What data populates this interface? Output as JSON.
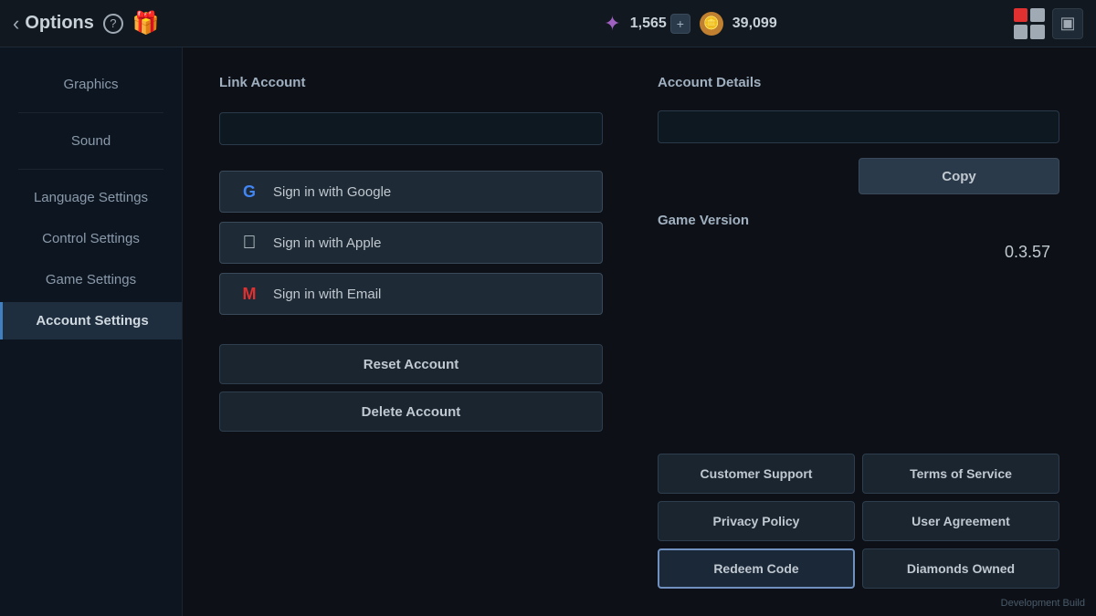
{
  "topbar": {
    "back_label": "Options",
    "help_icon": "?",
    "currency1_value": "1,565",
    "currency1_plus": "+",
    "currency2_value": "39,099",
    "dev_build": "Development Build"
  },
  "sidebar": {
    "items": [
      {
        "id": "graphics",
        "label": "Graphics",
        "active": false
      },
      {
        "id": "sound",
        "label": "Sound",
        "active": false
      },
      {
        "id": "language",
        "label": "Language Settings",
        "active": false
      },
      {
        "id": "control",
        "label": "Control Settings",
        "active": false
      },
      {
        "id": "game",
        "label": "Game Settings",
        "active": false
      },
      {
        "id": "account",
        "label": "Account Settings",
        "active": true
      }
    ]
  },
  "left_panel": {
    "link_account_label": "Link Account",
    "sign_in_buttons": [
      {
        "id": "google",
        "label": "Sign in with Google",
        "icon": "G"
      },
      {
        "id": "apple",
        "label": "Sign in with Apple",
        "icon": ""
      },
      {
        "id": "email",
        "label": "Sign in with Email",
        "icon": "M"
      }
    ],
    "reset_account_label": "Reset Account",
    "delete_account_label": "Delete Account"
  },
  "right_panel": {
    "account_details_label": "Account Details",
    "copy_label": "Copy",
    "game_version_label": "Game Version",
    "game_version_value": "0.3.57",
    "bottom_buttons": [
      {
        "id": "customer-support",
        "label": "Customer Support",
        "highlighted": false
      },
      {
        "id": "terms-of-service",
        "label": "Terms of Service",
        "highlighted": false
      },
      {
        "id": "privacy-policy",
        "label": "Privacy Policy",
        "highlighted": false
      },
      {
        "id": "user-agreement",
        "label": "User Agreement",
        "highlighted": false
      },
      {
        "id": "redeem-code",
        "label": "Redeem Code",
        "highlighted": true
      },
      {
        "id": "diamonds-owned",
        "label": "Diamonds Owned",
        "highlighted": false
      }
    ]
  }
}
